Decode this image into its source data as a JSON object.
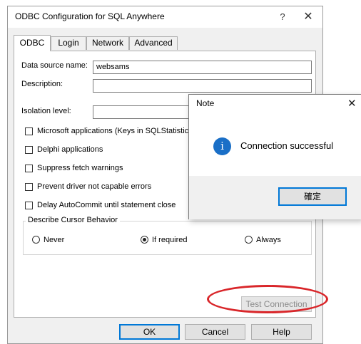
{
  "dialog": {
    "title": "ODBC Configuration for SQL Anywhere",
    "help_glyph": "?",
    "close_glyph": "✕"
  },
  "tabs": [
    {
      "label": "ODBC",
      "active": true
    },
    {
      "label": "Login",
      "active": false
    },
    {
      "label": "Network",
      "active": false
    },
    {
      "label": "Advanced",
      "active": false
    }
  ],
  "odbc": {
    "data_source_name": {
      "label": "Data source name:",
      "value": "websams"
    },
    "description": {
      "label": "Description:",
      "value": ""
    },
    "isolation_level": {
      "label": "Isolation level:",
      "value": ""
    },
    "checkboxes": [
      {
        "label": "Microsoft applications (Keys in SQLStatistics)",
        "checked": false
      },
      {
        "label": "Delphi applications",
        "checked": false
      },
      {
        "label": "Suppress fetch warnings",
        "checked": false
      },
      {
        "label": "Prevent driver not capable errors",
        "checked": false
      },
      {
        "label": "Delay AutoCommit until statement close",
        "checked": false
      }
    ],
    "cursor_group": {
      "title": "Describe Cursor Behavior",
      "options": [
        {
          "label": "Never",
          "checked": false
        },
        {
          "label": "If required",
          "checked": true
        },
        {
          "label": "Always",
          "checked": false
        }
      ]
    },
    "test_connection_label": "Test Connection"
  },
  "footer": {
    "ok_label": "OK",
    "cancel_label": "Cancel",
    "help_label": "Help"
  },
  "note": {
    "title": "Note",
    "close_glyph": "✕",
    "icon_glyph": "i",
    "message": "Connection successful",
    "ok_label": "確定"
  },
  "colors": {
    "info_icon": "#1a6fc7",
    "highlight": "#d9262a",
    "default_button_border": "#0078d7"
  }
}
